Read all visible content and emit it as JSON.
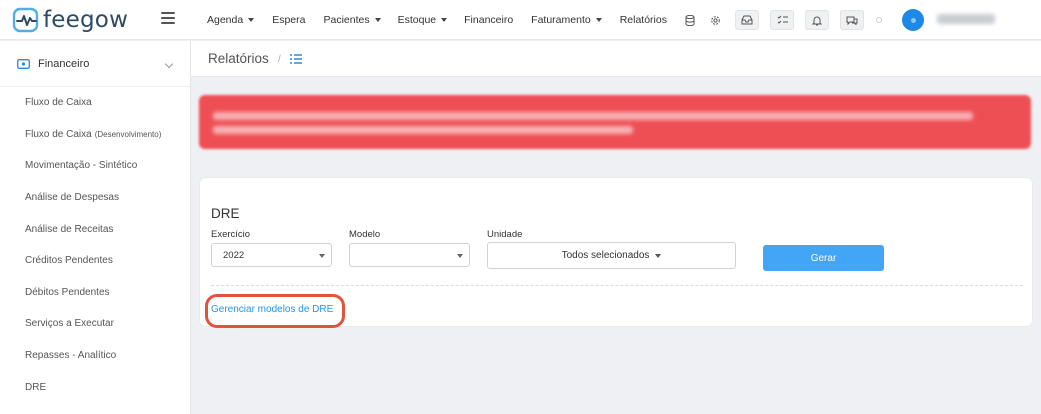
{
  "brand": {
    "name": "feegow"
  },
  "nav": {
    "items": [
      {
        "label": "Agenda",
        "dropdown": true
      },
      {
        "label": "Espera",
        "dropdown": false
      },
      {
        "label": "Pacientes",
        "dropdown": true
      },
      {
        "label": "Estoque",
        "dropdown": true
      },
      {
        "label": "Financeiro",
        "dropdown": false
      },
      {
        "label": "Faturamento",
        "dropdown": true
      },
      {
        "label": "Relatórios",
        "dropdown": false
      }
    ]
  },
  "sidebar": {
    "section_label": "Financeiro",
    "items": [
      {
        "label": "Fluxo de Caixa",
        "suffix": ""
      },
      {
        "label": "Fluxo de Caixa",
        "suffix": "(Desenvolvimento)"
      },
      {
        "label": "Movimentação - Sintético",
        "suffix": ""
      },
      {
        "label": "Análise de Despesas",
        "suffix": ""
      },
      {
        "label": "Análise de Receitas",
        "suffix": ""
      },
      {
        "label": "Créditos Pendentes",
        "suffix": ""
      },
      {
        "label": "Débitos Pendentes",
        "suffix": ""
      },
      {
        "label": "Serviços a Executar",
        "suffix": ""
      },
      {
        "label": "Repasses - Analítico",
        "suffix": ""
      },
      {
        "label": "DRE",
        "suffix": ""
      }
    ]
  },
  "page": {
    "title": "Relatórios",
    "breadcrumb_sep": "/"
  },
  "form": {
    "title": "DRE",
    "exercicio_label": "Exercício",
    "exercicio_value": "2022",
    "modelo_label": "Modelo",
    "modelo_value": "",
    "unidade_label": "Unidade",
    "unidade_value": "Todos selecionados",
    "gerar_label": "Gerar",
    "manage_link": "Gerenciar modelos de DRE"
  },
  "colors": {
    "accent": "#42a5f5",
    "alert": "#ee4f55",
    "highlight": "#e0533c",
    "link": "#2196f3"
  }
}
